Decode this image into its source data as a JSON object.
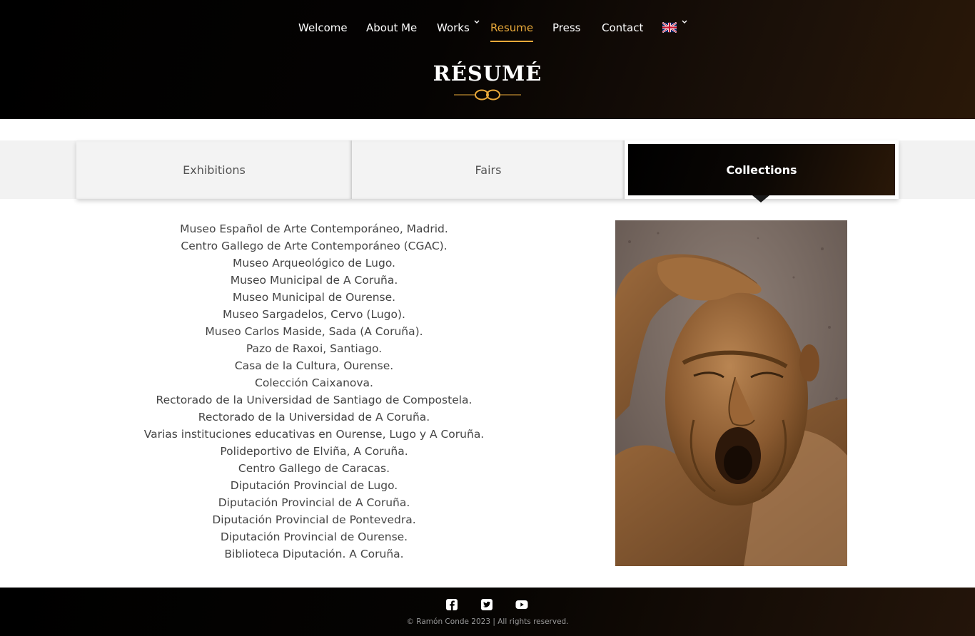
{
  "nav": {
    "items": [
      {
        "label": "Welcome"
      },
      {
        "label": "About Me"
      },
      {
        "label": "Works"
      },
      {
        "label": "Resume"
      },
      {
        "label": "Press"
      },
      {
        "label": "Contact"
      }
    ],
    "active": "Resume",
    "language_icon": "uk-flag-icon"
  },
  "header": {
    "title": "RÉSUMÉ"
  },
  "tabs": {
    "items": [
      {
        "label": "Exhibitions"
      },
      {
        "label": "Fairs"
      },
      {
        "label": "Collections"
      }
    ],
    "active": "Collections"
  },
  "collections": [
    "Museo Español de Arte Contemporáneo, Madrid.",
    "Centro Gallego de Arte Contemporáneo (CGAC).",
    "Museo Arqueológico de Lugo.",
    "Museo Municipal de A Coruña.",
    "Museo Municipal de Ourense.",
    "Museo Sargadelos, Cervo (Lugo).",
    "Museo Carlos Maside, Sada (A Coruña).",
    "Pazo de Raxoi, Santiago.",
    "Casa de la Cultura, Ourense.",
    "Colección Caixanova.",
    "Rectorado de la Universidad de Santiago de Compostela.",
    "Rectorado de la Universidad de A Coruña.",
    "Varias instituciones educativas en Ourense, Lugo y A Coruña.",
    "Polideportivo de Elviña, A Coruña.",
    "Centro Gallego de Caracas.",
    "Diputación Provincial de Lugo.",
    "Diputación Provincial de A Coruña.",
    "Diputación Provincial de Pontevedra.",
    "Diputación Provincial de Ourense.",
    "Biblioteca Diputación. A Coruña."
  ],
  "footer": {
    "social": [
      "facebook-icon",
      "twitter-icon",
      "youtube-icon"
    ],
    "copyright": "© Ramón Conde 2023 | All rights reserved."
  },
  "colors": {
    "accent": "#e9a93a",
    "dark": "#000000",
    "bronze": "#8b5a2b"
  }
}
